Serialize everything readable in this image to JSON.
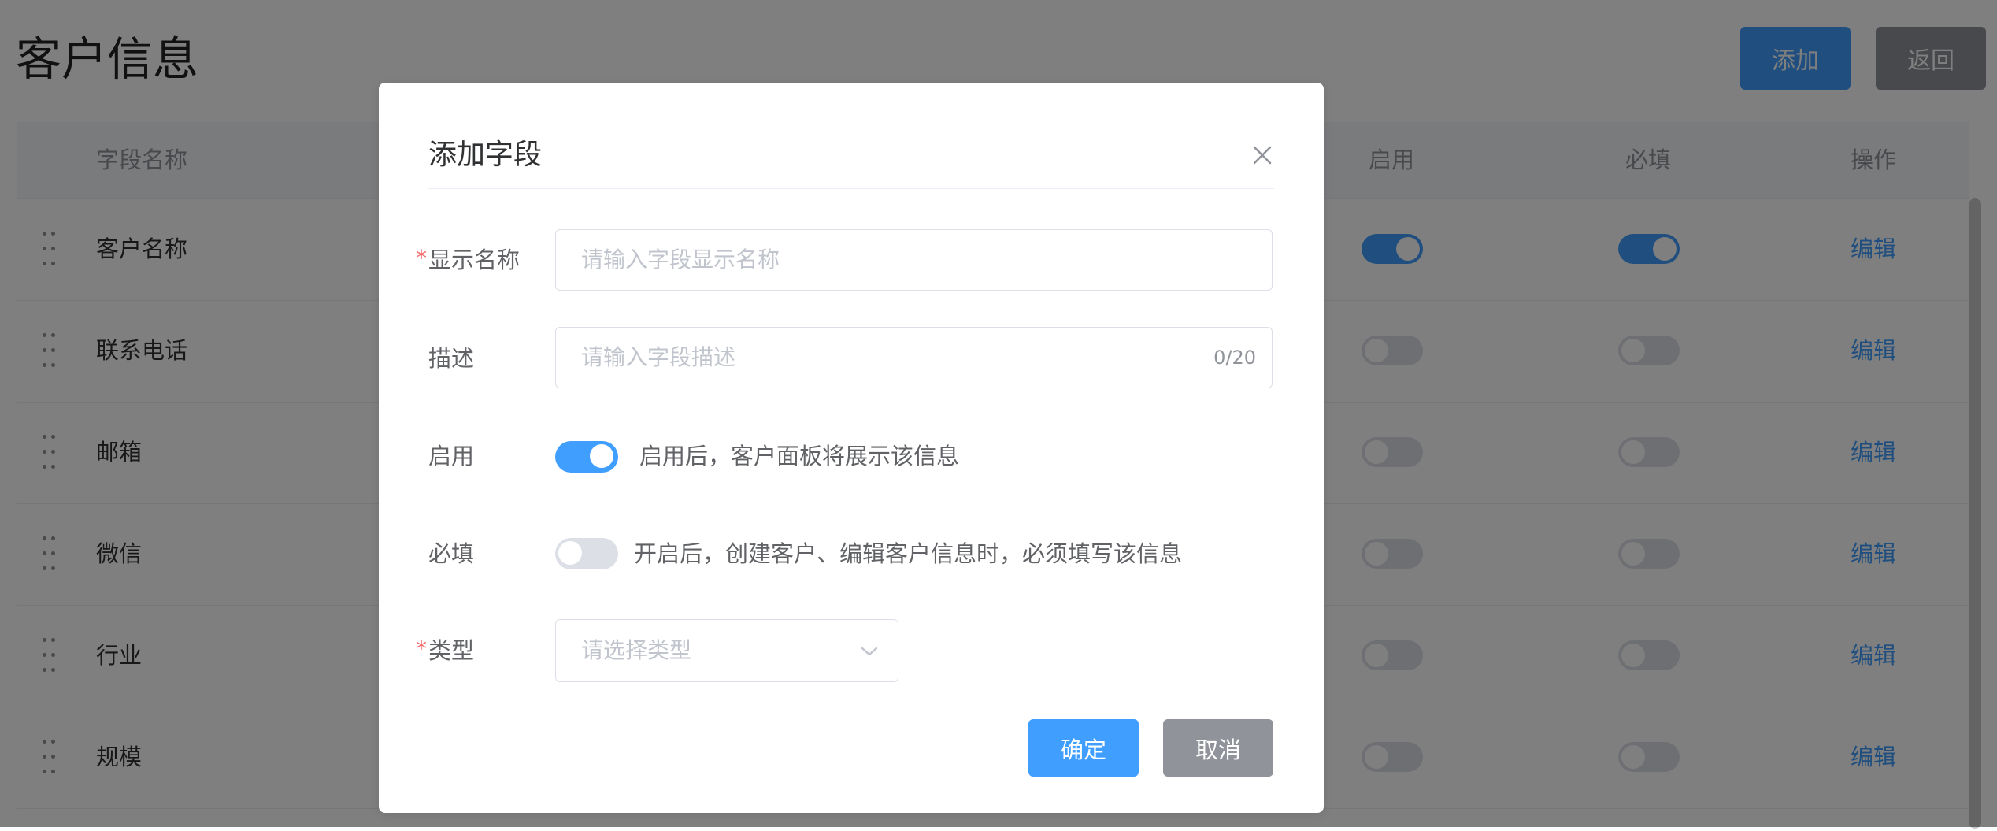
{
  "page": {
    "title": "客户信息",
    "add_label": "添加",
    "back_label": "返回"
  },
  "table": {
    "headers": {
      "field_name": "字段名称",
      "enabled": "启用",
      "required": "必填",
      "actions": "操作"
    },
    "edit_label": "编辑",
    "rows": [
      {
        "name": "客户名称",
        "enabled": true,
        "required": true
      },
      {
        "name": "联系电话",
        "enabled": false,
        "required": false
      },
      {
        "name": "邮箱",
        "enabled": false,
        "required": false
      },
      {
        "name": "微信",
        "enabled": false,
        "required": false
      },
      {
        "name": "行业",
        "enabled": false,
        "required": false
      },
      {
        "name": "规模",
        "enabled": false,
        "required": false
      }
    ]
  },
  "dialog": {
    "title": "添加字段",
    "required_mark": "*",
    "display_name": {
      "label": "显示名称",
      "placeholder": "请输入字段显示名称"
    },
    "description": {
      "label": "描述",
      "placeholder": "请输入字段描述",
      "counter": "0/20"
    },
    "enable": {
      "label": "启用",
      "on": true,
      "hint": "启用后，客户面板将展示该信息"
    },
    "required": {
      "label": "必填",
      "on": false,
      "hint": "开启后，创建客户、编辑客户信息时，必须填写该信息"
    },
    "type": {
      "label": "类型",
      "placeholder": "请选择类型"
    },
    "ok_label": "确定",
    "cancel_label": "取消"
  },
  "colors": {
    "primary": "#409eff",
    "secondary": "#909399",
    "danger": "#f56c6c"
  },
  "icons": {
    "close": "close-icon",
    "drag": "drag-handle-icon",
    "dropdown": "chevron-down-icon"
  }
}
